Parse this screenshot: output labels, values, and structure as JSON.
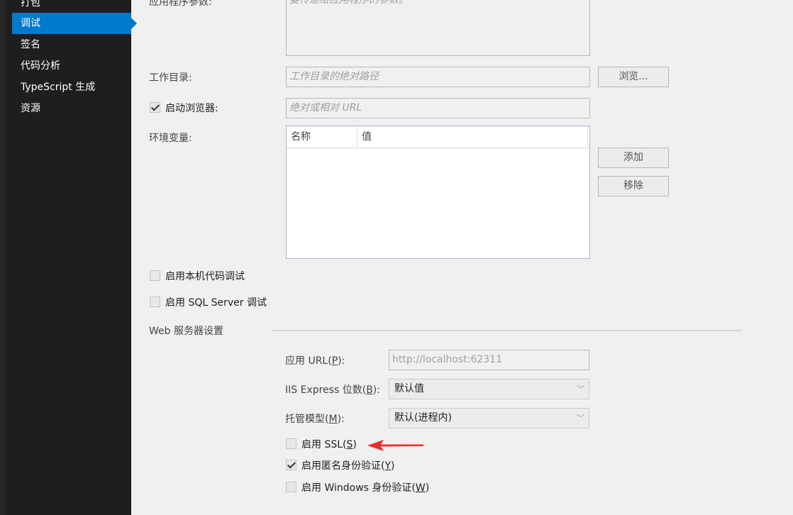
{
  "sidebar": {
    "items": [
      {
        "label": "打包",
        "active": false
      },
      {
        "label": "调试",
        "active": true
      },
      {
        "label": "签名",
        "active": false
      },
      {
        "label": "代码分析",
        "active": false
      },
      {
        "label": "TypeScript 生成",
        "active": false
      },
      {
        "label": "资源",
        "active": false
      }
    ]
  },
  "form": {
    "app_args_label": "应用程序参数:",
    "app_args_placeholder": "要传递给应用程序的参数。",
    "workdir_label": "工作目录:",
    "workdir_placeholder": "工作目录的绝对路径",
    "browse_button": "浏览...",
    "launch_browser_label": "启动浏览器:",
    "launch_browser_checked": true,
    "launch_browser_placeholder": "绝对或相对 URL",
    "env_label": "环境变量:",
    "env_columns": [
      "名称",
      "值"
    ],
    "add_button": "添加",
    "remove_button": "移除",
    "native_debug_label": "启用本机代码调试",
    "sql_debug_label": "启用 SQL Server 调试"
  },
  "web": {
    "section_title": "Web 服务器设置",
    "app_url_label_pre": "应用 URL(",
    "app_url_key": "P",
    "app_url_label_post": "):",
    "app_url_value": "http://localhost:62311",
    "bitness_label_pre": "IIS Express 位数(",
    "bitness_key": "B",
    "bitness_label_post": "):",
    "bitness_value": "默认值",
    "hosting_label_pre": "托管模型(",
    "hosting_key": "M",
    "hosting_label_post": "):",
    "hosting_value": "默认(进程内)",
    "ssl_label_pre": "启用 SSL(",
    "ssl_key": "S",
    "ssl_label_post": ")",
    "ssl_checked": false,
    "anon_label_pre": "启用匿名身份验证(",
    "anon_key": "Y",
    "anon_label_post": ")",
    "anon_checked": true,
    "windows_label_pre": "启用 Windows 身份验证(",
    "windows_key": "W",
    "windows_label_post": ")",
    "windows_checked": false
  },
  "colors": {
    "accent": "#007acc",
    "sidebar_bg": "#1e1e1e",
    "annotation_arrow": "#e8302a"
  }
}
